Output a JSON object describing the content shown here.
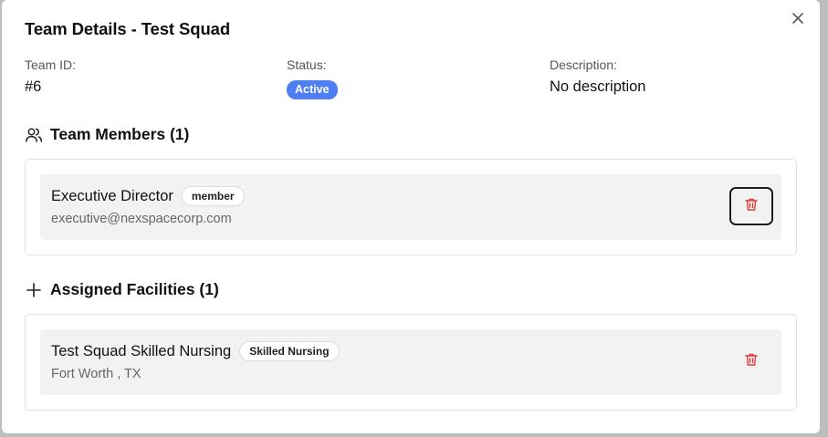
{
  "dialog": {
    "title": "Team Details - Test Squad",
    "close_icon": "x-icon"
  },
  "info": {
    "team_id_label": "Team ID:",
    "team_id_value": "#6",
    "status_label": "Status:",
    "status_value": "Active",
    "status_color": "#4f7df3",
    "description_label": "Description:",
    "description_value": "No description"
  },
  "members_section": {
    "icon": "users-icon",
    "title": "Team Members (1)",
    "items": [
      {
        "name": "Executive Director",
        "role": "member",
        "email": "executive@nexspacecorp.com",
        "delete_icon": "trash-icon",
        "delete_focused": true
      }
    ]
  },
  "facilities_section": {
    "icon": "plus-icon",
    "title": "Assigned Facilities (1)",
    "items": [
      {
        "name": "Test Squad Skilled Nursing",
        "type": "Skilled Nursing",
        "location": "Fort Worth , TX",
        "delete_icon": "trash-icon",
        "delete_focused": false
      }
    ]
  },
  "colors": {
    "delete_icon": "#e03b3b",
    "row_background": "#f2f2f2",
    "card_border": "#e2e2e2"
  }
}
